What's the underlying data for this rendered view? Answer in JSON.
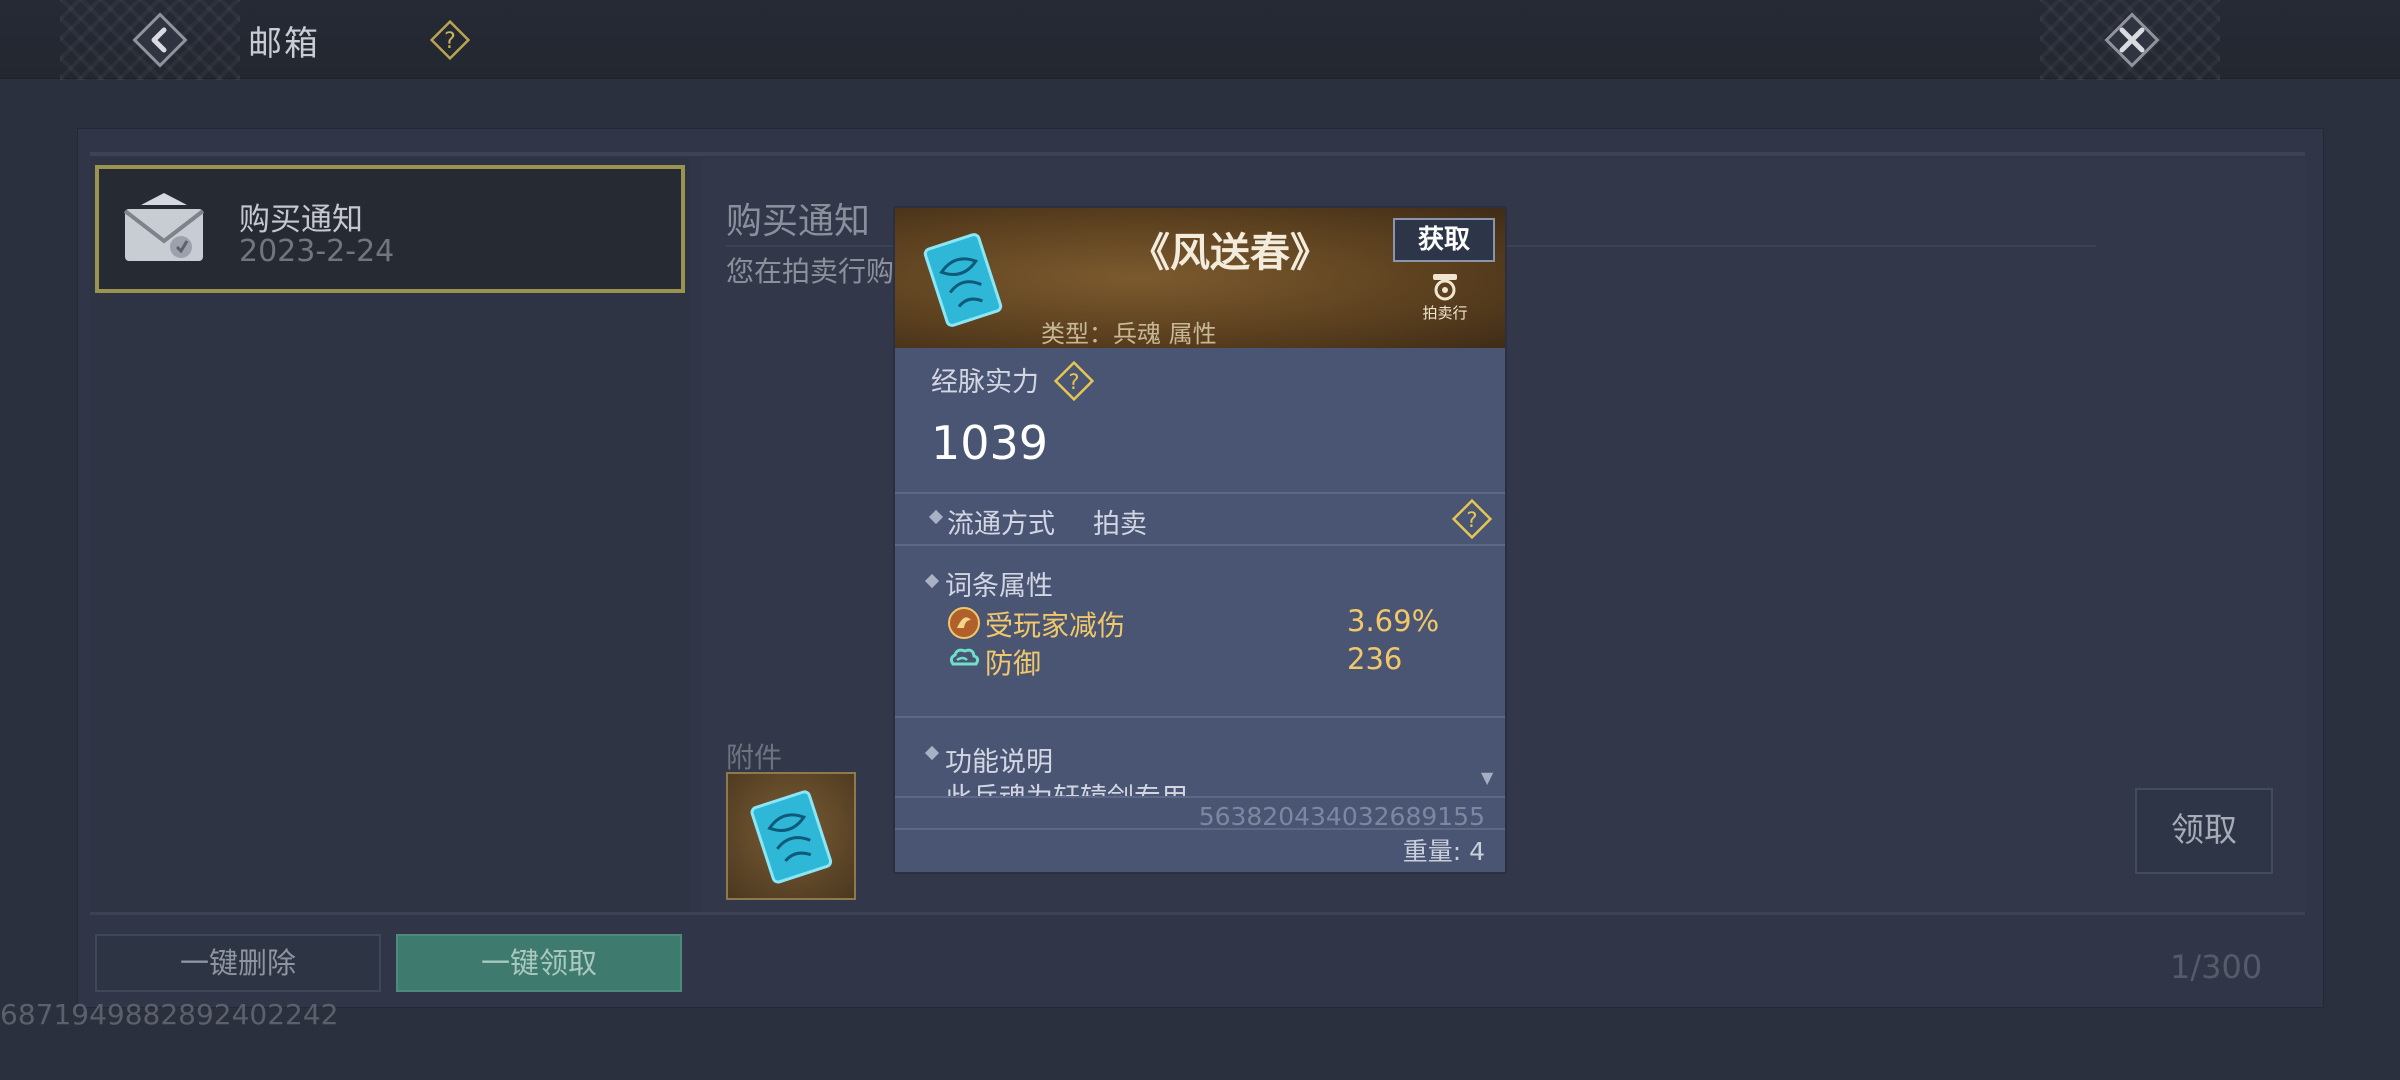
{
  "header": {
    "title": "邮箱",
    "back_icon": "back-arrow-icon",
    "help_icon": "question-diamond-icon",
    "close_icon": "close-x-icon"
  },
  "mail_list": {
    "items": [
      {
        "name": "购买通知",
        "date": "2023-2-24",
        "icon": "envelope-icon",
        "selected": true
      }
    ]
  },
  "mail_detail": {
    "title": "购买通知",
    "body": "您在拍卖行购",
    "attachments_label": "附件",
    "attachment_icon": "blue-scroll-icon",
    "claim_label": "领取"
  },
  "footer": {
    "delete_all_label": "一键删除",
    "claim_all_label": "一键领取",
    "count": "1/300",
    "uid": "6871949882892402242"
  },
  "item_card": {
    "name": "《风送春》",
    "type": "类型：兵魂 属性",
    "acquire_label": "获取",
    "auction_label": "拍卖行",
    "power_label": "经脉实力",
    "power_value": "1039",
    "circulation_label": "流通方式",
    "circulation_value": "拍卖",
    "attributes_label": "词条属性",
    "attributes": [
      {
        "name": "受玩家减伤",
        "value": "3.69%",
        "icon": "fire-swirl-icon"
      },
      {
        "name": "防御",
        "value": "236",
        "icon": "cloud-icon"
      }
    ],
    "function_label": "功能说明",
    "function_text": "此兵魂为轩辕剑专用",
    "item_id": "563820434032689155",
    "weight": "重量: 4",
    "colors": {
      "gold": "#f0c86a",
      "header_brown": "#7c5a2e",
      "card_bg": "#4a5574"
    }
  }
}
